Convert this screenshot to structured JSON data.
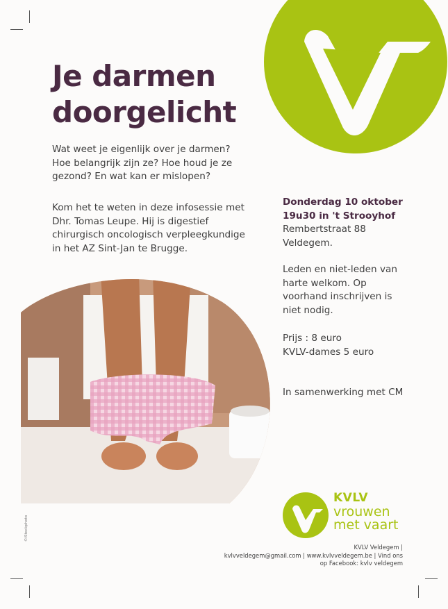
{
  "title_line1": "Je darmen",
  "title_line2": "doorgelicht",
  "intro": [
    "Wat weet je eigenlijk over je darmen?",
    "Hoe belangrijk zijn ze? Hoe houd je ze",
    "gezond? En wat kan er mislopen?"
  ],
  "speaker": [
    "Kom het te weten in deze infosessie met",
    "Dhr. Tomas Leupe. Hij is digestief",
    "chirurgisch oncologisch verpleegkundige",
    "in het AZ Sint-Jan te Brugge."
  ],
  "event": {
    "date": "Donderdag 10 oktober",
    "time_place": "19u30 in 't Strooyhof",
    "address1": "Rembertstraat  88",
    "address2": "Veldegem."
  },
  "welcome": [
    "Leden en niet-leden van",
    "harte welkom. Op",
    "voorhand inschrijven is",
    "niet nodig."
  ],
  "price": [
    "Prijs : 8 euro",
    "KVLV-dames 5 euro"
  ],
  "partner": "In samenwerking met CM",
  "brand": {
    "name": "KVLV",
    "tag1": "vrouwen",
    "tag2": "met vaart"
  },
  "footer": [
    "KVLV Veldegem |",
    "kvlvveldegem@gmail.com | www.kvlvveldegem.be | Vind ons",
    "op Facebook: kvlv veldegem"
  ],
  "photo_credit": "©iStockphoto",
  "colors": {
    "accent": "#a9c313",
    "title": "#4a2a43"
  },
  "icons": {
    "logo": "kvlv-v-logo"
  }
}
